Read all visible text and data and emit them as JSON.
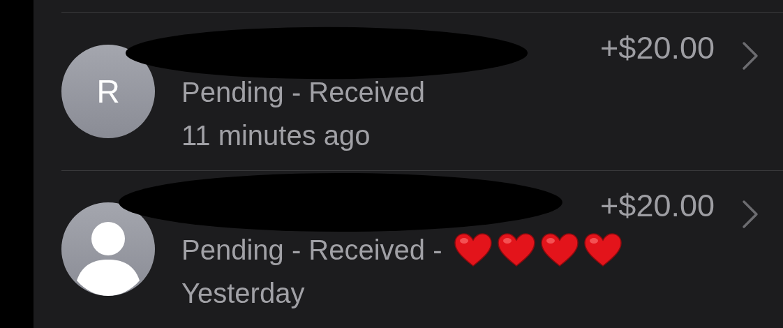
{
  "transactions": [
    {
      "avatar": {
        "kind": "initial",
        "initial": "R"
      },
      "amount": "+$20.00",
      "status": "Pending - Received",
      "time": "11 minutes ago"
    },
    {
      "avatar": {
        "kind": "silhouette"
      },
      "amount": "+$20.00",
      "status": "Pending - Received -",
      "reactions": [
        {
          "kind": "heart"
        },
        {
          "kind": "heart"
        },
        {
          "kind": "heart"
        },
        {
          "kind": "heart"
        }
      ],
      "time": "Yesterday"
    }
  ]
}
